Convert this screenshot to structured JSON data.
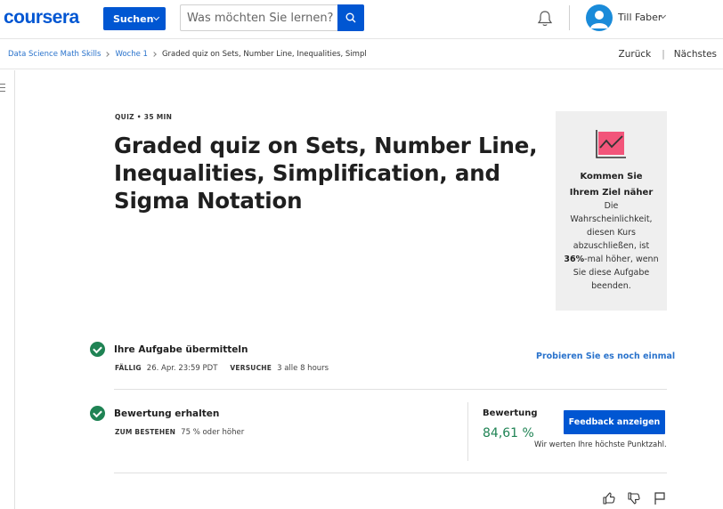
{
  "header": {
    "logo_text": "coursera",
    "search_dropdown_label": "Suchen",
    "search_placeholder": "Was möchten Sie lernen?",
    "user_name": "Till Faber"
  },
  "breadcrumb": {
    "items": [
      "Data Science Math Skills",
      "Woche 1",
      "Graded quiz on Sets, Number Line, Inequalities, Simpl"
    ],
    "back_label": "Zurück",
    "next_label": "Nächstes"
  },
  "quiz": {
    "meta": "QUIZ • 35 MIN",
    "title": "Graded quiz on Sets, Number Line, Inequalities, Simplification, and Sigma Notation"
  },
  "goal_card": {
    "title_line1": "Kommen Sie",
    "title_line2": "Ihrem Ziel näher",
    "text_before": "Die Wahrscheinlichkeit, diesen Kurs abzuschließen, ist ",
    "percent": "36%",
    "text_after": "-mal höher, wenn Sie diese Aufgabe beenden."
  },
  "submit_step": {
    "title": "Ihre Aufgabe übermitteln",
    "due_key": "FÄLLIG",
    "due_value": "26. Apr. 23:59 PDT",
    "attempts_key": "VERSUCHE",
    "attempts_value": "3 alle 8 hours",
    "retry_label": "Probieren Sie es noch einmal"
  },
  "grade_step": {
    "title": "Bewertung erhalten",
    "pass_key": "ZUM BESTEHEN",
    "pass_value": "75 % oder höher",
    "grade_label": "Bewertung",
    "grade_value": "84,61 %",
    "feedback_button": "Feedback anzeigen",
    "highest_note": "Wir werten Ihre höchste Punktzahl."
  },
  "colors": {
    "brand_blue": "#0056d2",
    "link_blue": "#2a73cc",
    "success_green": "#1f8354",
    "goal_icon_pink": "#f2557a"
  },
  "icons": [
    "search-icon",
    "bell-icon",
    "avatar-icon",
    "chart-icon",
    "check-icon",
    "thumbs-up-icon",
    "thumbs-down-icon",
    "flag-icon"
  ]
}
